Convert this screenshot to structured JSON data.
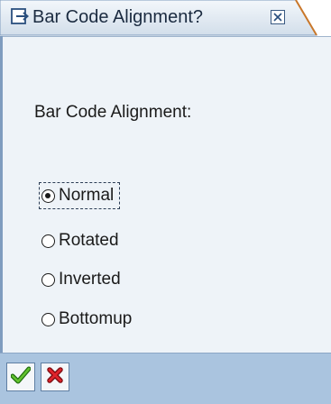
{
  "window": {
    "title": "Bar Code Alignment?",
    "title_icon": "dialog-arrow-icon",
    "close_icon": "close-box-icon"
  },
  "form": {
    "label": "Bar Code Alignment:",
    "selected": "Normal",
    "options": [
      {
        "label": "Normal",
        "checked": true
      },
      {
        "label": "Rotated",
        "checked": false
      },
      {
        "label": "Inverted",
        "checked": false
      },
      {
        "label": "Bottomup",
        "checked": false
      }
    ]
  },
  "footer": {
    "ok_icon": "checkmark-icon",
    "cancel_icon": "cancel-x-icon"
  },
  "colors": {
    "title_bg": "#cfdcea",
    "body_bg": "#eef3f8",
    "footer_bg": "#aac4df",
    "ok_green": "#3a9a1e",
    "cancel_red": "#c0141c"
  }
}
